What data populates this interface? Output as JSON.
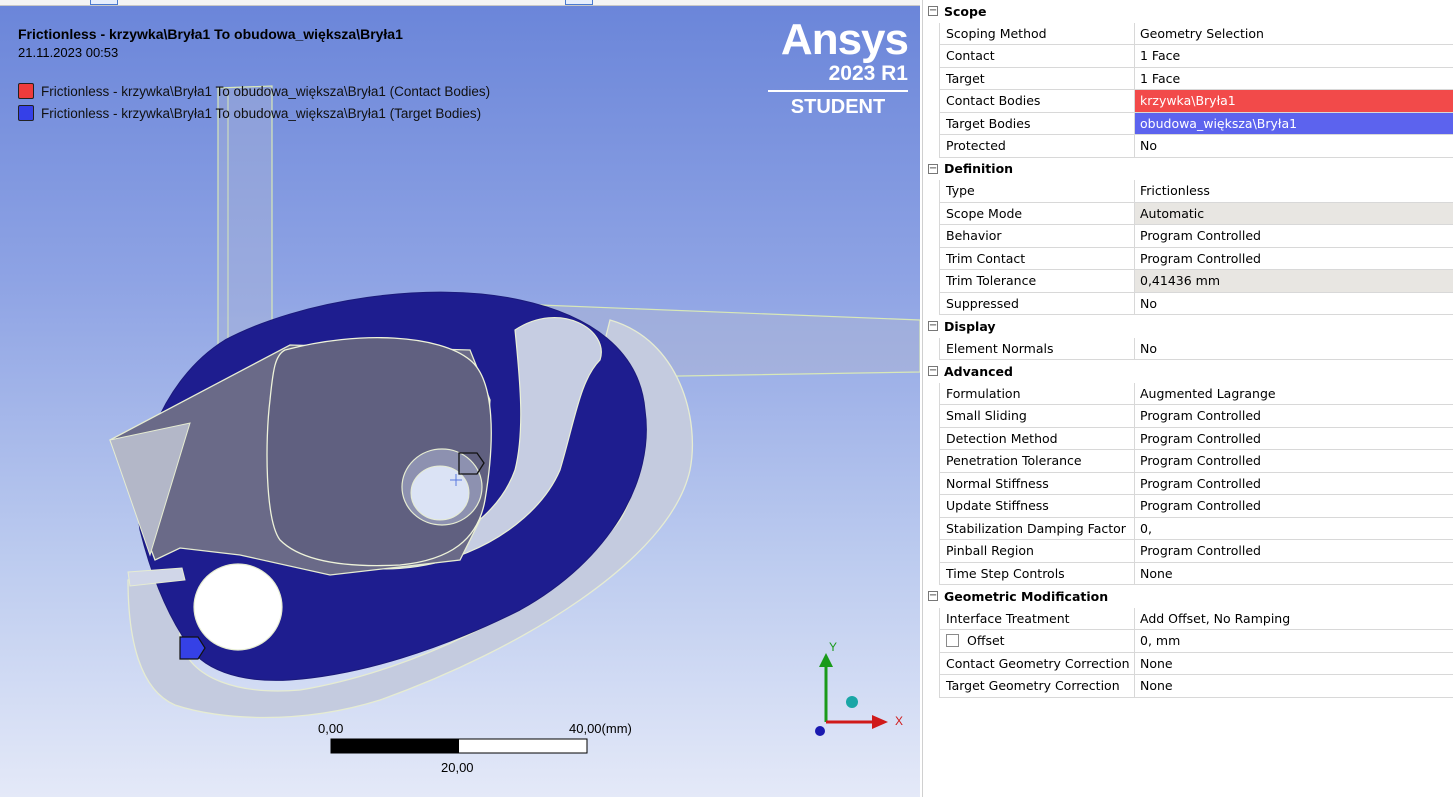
{
  "viewport": {
    "title": "Frictionless - krzywka\\Bryła1 To obudowa_większa\\Bryła1",
    "datetime": "21.11.2023 00:53",
    "legend": [
      {
        "label": "Frictionless - krzywka\\Bryła1 To obudowa_większa\\Bryła1 (Contact Bodies)",
        "color": "#ef3b3b"
      },
      {
        "label": "Frictionless - krzywka\\Bryła1 To obudowa_większa\\Bryła1 (Target Bodies)",
        "color": "#3540e8"
      }
    ],
    "logo": {
      "name": "Ansys",
      "version": "2023 R1",
      "edition": "STUDENT"
    },
    "scale_bar": {
      "left": "0,00",
      "right": "40,00",
      "unit": "(mm)",
      "mid": "20,00"
    },
    "triad": {
      "y_label": "Y",
      "x_label": "X"
    }
  },
  "details": {
    "groups": [
      {
        "label": "Scope",
        "props": [
          {
            "name": "Scoping Method",
            "value": "Geometry Selection"
          },
          {
            "name": "Contact",
            "value": "1 Face"
          },
          {
            "name": "Target",
            "value": "1 Face"
          },
          {
            "name": "Contact Bodies",
            "value": "krzywka\\Bryła1",
            "style": "red"
          },
          {
            "name": "Target Bodies",
            "value": "obudowa_większa\\Bryła1",
            "style": "blue"
          },
          {
            "name": "Protected",
            "value": "No"
          }
        ]
      },
      {
        "label": "Definition",
        "props": [
          {
            "name": "Type",
            "value": "Frictionless"
          },
          {
            "name": "Scope Mode",
            "value": "Automatic",
            "style": "gray"
          },
          {
            "name": "Behavior",
            "value": "Program Controlled"
          },
          {
            "name": "Trim Contact",
            "value": "Program Controlled"
          },
          {
            "name": "Trim Tolerance",
            "value": "0,41436 mm",
            "style": "gray"
          },
          {
            "name": "Suppressed",
            "value": "No"
          }
        ]
      },
      {
        "label": "Display",
        "props": [
          {
            "name": "Element Normals",
            "value": "No"
          }
        ]
      },
      {
        "label": "Advanced",
        "props": [
          {
            "name": "Formulation",
            "value": "Augmented Lagrange"
          },
          {
            "name": "Small Sliding",
            "value": "Program Controlled"
          },
          {
            "name": "Detection Method",
            "value": "Program Controlled"
          },
          {
            "name": "Penetration Tolerance",
            "value": "Program Controlled"
          },
          {
            "name": "Normal Stiffness",
            "value": "Program Controlled"
          },
          {
            "name": "Update Stiffness",
            "value": "Program Controlled"
          },
          {
            "name": "Stabilization Damping Factor",
            "value": "0,"
          },
          {
            "name": "Pinball Region",
            "value": "Program Controlled"
          },
          {
            "name": "Time Step Controls",
            "value": "None"
          }
        ]
      },
      {
        "label": "Geometric Modification",
        "props": [
          {
            "name": "Interface Treatment",
            "value": "Add Offset, No Ramping"
          },
          {
            "name": "Offset",
            "value": "0, mm",
            "checkbox": true
          },
          {
            "name": "Contact Geometry Correction",
            "value": "None"
          },
          {
            "name": "Target Geometry Correction",
            "value": "None"
          }
        ]
      }
    ]
  }
}
